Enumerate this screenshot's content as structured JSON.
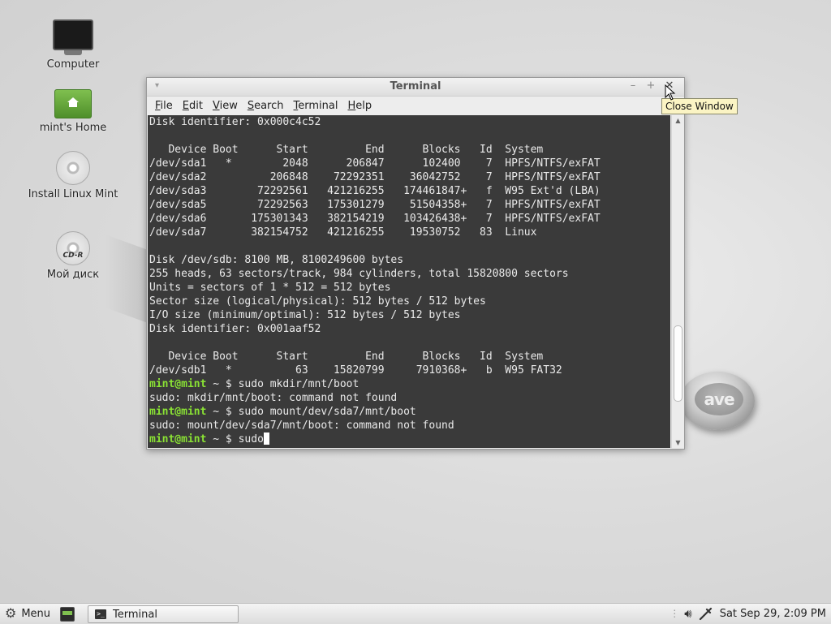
{
  "desktop": {
    "icons": [
      {
        "label": "Computer"
      },
      {
        "label": "mint's Home"
      },
      {
        "label": "Install Linux Mint"
      },
      {
        "label": "Мой диск",
        "badge": "CD-R"
      }
    ],
    "logo_text": "ave"
  },
  "window": {
    "title": "Terminal",
    "menu_glyph": "▾",
    "minimize_glyph": "–",
    "maximize_glyph": "+",
    "close_glyph": "✕",
    "menus": [
      {
        "u": "F",
        "rest": "ile"
      },
      {
        "u": "E",
        "rest": "dit"
      },
      {
        "u": "V",
        "rest": "iew"
      },
      {
        "u": "S",
        "rest": "earch"
      },
      {
        "u": "T",
        "rest": "erminal"
      },
      {
        "u": "H",
        "rest": "elp"
      }
    ]
  },
  "terminal": {
    "lines": [
      "Disk identifier: 0x000c4c52",
      "",
      "   Device Boot      Start         End      Blocks   Id  System",
      "/dev/sda1   *        2048      206847      102400    7  HPFS/NTFS/exFAT",
      "/dev/sda2          206848    72292351    36042752    7  HPFS/NTFS/exFAT",
      "/dev/sda3        72292561   421216255   174461847+   f  W95 Ext'd (LBA)",
      "/dev/sda5        72292563   175301279    51504358+   7  HPFS/NTFS/exFAT",
      "/dev/sda6       175301343   382154219   103426438+   7  HPFS/NTFS/exFAT",
      "/dev/sda7       382154752   421216255    19530752   83  Linux",
      "",
      "Disk /dev/sdb: 8100 MB, 8100249600 bytes",
      "255 heads, 63 sectors/track, 984 cylinders, total 15820800 sectors",
      "Units = sectors of 1 * 512 = 512 bytes",
      "Sector size (logical/physical): 512 bytes / 512 bytes",
      "I/O size (minimum/optimal): 512 bytes / 512 bytes",
      "Disk identifier: 0x001aaf52",
      "",
      "   Device Boot      Start         End      Blocks   Id  System",
      "/dev/sdb1   *          63    15820799     7910368+   b  W95 FAT32"
    ],
    "session": [
      {
        "type": "prompt",
        "cmd": "sudo mkdir/mnt/boot"
      },
      {
        "type": "out",
        "text": "sudo: mkdir/mnt/boot: command not found"
      },
      {
        "type": "prompt",
        "cmd": "sudo mount/dev/sda7/mnt/boot"
      },
      {
        "type": "out",
        "text": "sudo: mount/dev/sda7/mnt/boot: command not found"
      },
      {
        "type": "prompt",
        "cmd": "sudo",
        "active": true
      }
    ],
    "prompt_user": "mint@mint",
    "prompt_rest": " ~ $ ",
    "scroll_position": 0.85
  },
  "tooltip": {
    "text": "Close Window"
  },
  "panel": {
    "menu_label": "Menu",
    "task_label": "Terminal",
    "clock": "Sat Sep 29,  2:09 PM"
  },
  "colors": {
    "prompt": "#8ae234",
    "terminal_bg": "#3a3a3a"
  }
}
